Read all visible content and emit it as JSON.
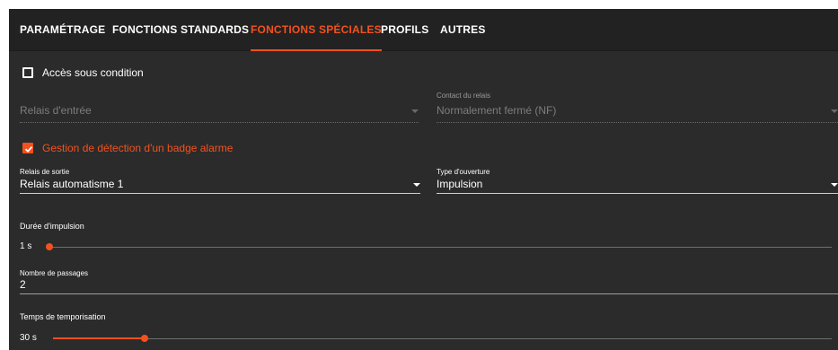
{
  "tabs": [
    {
      "label": "PARAMÉTRAGE",
      "active": false
    },
    {
      "label": "FONCTIONS STANDARDS",
      "active": false
    },
    {
      "label": "FONCTIONS SPÉCIALES",
      "active": true
    },
    {
      "label": "PROFILS",
      "active": false
    },
    {
      "label": "AUTRES",
      "active": false
    }
  ],
  "access_condition": {
    "label": "Accès sous condition",
    "checked": false
  },
  "input_relay": {
    "placeholder": "Relais d'entrée"
  },
  "relay_contact": {
    "label": "Contact du relais",
    "value": "Normalement fermé (NF)"
  },
  "alarm_badge": {
    "label": "Gestion de détection d'un badge alarme",
    "checked": true
  },
  "output_relay": {
    "label": "Relais de sortie",
    "value": "Relais automatisme 1"
  },
  "opening_type": {
    "label": "Type d'ouverture",
    "value": "Impulsion"
  },
  "pulse_duration": {
    "label": "Durée d'impulsion",
    "value": "1 s",
    "fraction": 0.0
  },
  "pass_count": {
    "label": "Nombre de passages",
    "value": "2"
  },
  "delay_time": {
    "label": "Temps de temporisation",
    "value": "30 s",
    "fraction": 0.118
  },
  "colors": {
    "accent": "#f4511e",
    "background": "#2b2b2b",
    "tabbar": "#222222",
    "text": "#ffffff",
    "muted": "#7d7d7d"
  }
}
